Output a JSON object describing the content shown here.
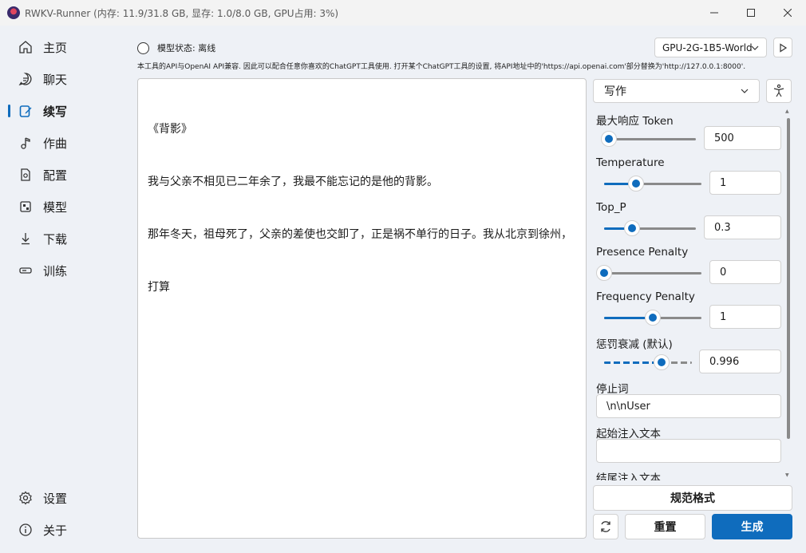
{
  "window": {
    "title": "RWKV-Runner (内存: 11.9/31.8 GB, 显存: 1.0/8.0 GB, GPU占用: 3%)"
  },
  "sidebar": {
    "items": [
      {
        "label": "主页",
        "icon": "home-icon"
      },
      {
        "label": "聊天",
        "icon": "chat-icon"
      },
      {
        "label": "续写",
        "icon": "compose-icon",
        "active": true
      },
      {
        "label": "作曲",
        "icon": "music-note-icon"
      },
      {
        "label": "配置",
        "icon": "settings-doc-icon"
      },
      {
        "label": "模型",
        "icon": "model-icon"
      },
      {
        "label": "下载",
        "icon": "download-icon"
      },
      {
        "label": "训练",
        "icon": "train-icon"
      }
    ],
    "bottom": [
      {
        "label": "设置",
        "icon": "gear-icon"
      },
      {
        "label": "关于",
        "icon": "info-icon"
      }
    ]
  },
  "header": {
    "status": "模型状态: 离线",
    "model": "GPU-2G-1B5-World",
    "notice": "本工具的API与OpenAI API兼容. 因此可以配合任意你喜欢的ChatGPT工具使用. 打开某个ChatGPT工具的设置, 将API地址中的'https://api.openai.com'部分替换为'http://127.0.0.1:8000'."
  },
  "editor": {
    "lines": [
      "《背影》",
      "我与父亲不相见已二年余了，我最不能忘记的是他的背影。",
      "那年冬天，祖母死了，父亲的差使也交卸了，正是祸不单行的日子。我从北京到徐州，",
      "打算"
    ]
  },
  "panel": {
    "mode": "写作",
    "params": {
      "max_tokens": {
        "label": "最大响应 Token",
        "value": "500",
        "fraction": 0.05
      },
      "temperature": {
        "label": "Temperature",
        "value": "1",
        "fraction": 0.33
      },
      "top_p": {
        "label": "Top_P",
        "value": "0.3",
        "fraction": 0.3
      },
      "presence": {
        "label": "Presence Penalty",
        "value": "0",
        "fraction": 0.0
      },
      "frequency": {
        "label": "Frequency Penalty",
        "value": "1",
        "fraction": 0.5
      },
      "decay": {
        "label": "惩罚衰减 (默认)",
        "value": "0.996",
        "fraction": 0.65
      },
      "stop": {
        "label": "停止词",
        "value": "\\n\\nUser"
      },
      "inject_start": {
        "label": "起始注入文本",
        "value": ""
      },
      "inject_end": {
        "label": "结尾注入文本"
      }
    }
  },
  "actions": {
    "format": "规范格式",
    "reset": "重置",
    "generate": "生成"
  },
  "colors": {
    "accent": "#0f6cbd"
  }
}
